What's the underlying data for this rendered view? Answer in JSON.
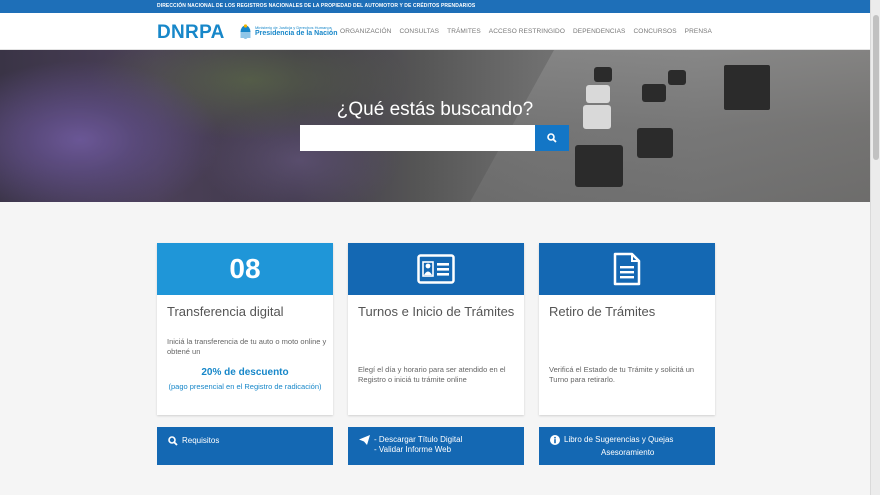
{
  "topbar": {
    "text": "DIRECCIÓN NACIONAL DE LOS REGISTROS NACIONALES DE LA PROPIEDAD DEL AUTOMOTOR Y DE CRÉDITOS PRENDARIOS"
  },
  "header": {
    "logo": "DNRPA",
    "gov_small": "Ministerio de Justicia y Derechos Humanos",
    "gov_big": "Presidencia de la Nación",
    "nav": [
      "ORGANIZACIÓN",
      "CONSULTAS",
      "TRÁMITES",
      "ACCESO RESTRINGIDO",
      "DEPENDENCIAS",
      "CONCURSOS",
      "PRENSA"
    ]
  },
  "hero": {
    "title": "¿Qué estás buscando?",
    "search_placeholder": ""
  },
  "cards": [
    {
      "head_color": "#1f96d8",
      "number": "08",
      "title": "Transferencia digital",
      "text": "Iniciá la transferencia de tu auto o moto online y obtené un",
      "highlight": "20% de descuento",
      "note": "(pago presencial en el Registro de radicación)"
    },
    {
      "head_color": "#1468b3",
      "icon": "id-card-icon",
      "title": "Turnos e Inicio de Trámites",
      "text": "Elegí el día y horario para ser atendido en el Registro o iniciá tu trámite online"
    },
    {
      "head_color": "#1468b3",
      "icon": "document-icon",
      "title": "Retiro de Trámites",
      "text": "Verificá el Estado de tu Trámite y solicitá un Turno para retirarlo."
    }
  ],
  "buttons": [
    {
      "icon": "search-icon",
      "label": "Requisitos"
    },
    {
      "icon": "paper-plane-icon",
      "line1": "- Descargar Título Digital",
      "line2": "- Validar Informe Web"
    },
    {
      "icon": "info-icon",
      "line1": "Libro de Sugerencias y Quejas",
      "line2": "Asesoramiento"
    }
  ]
}
